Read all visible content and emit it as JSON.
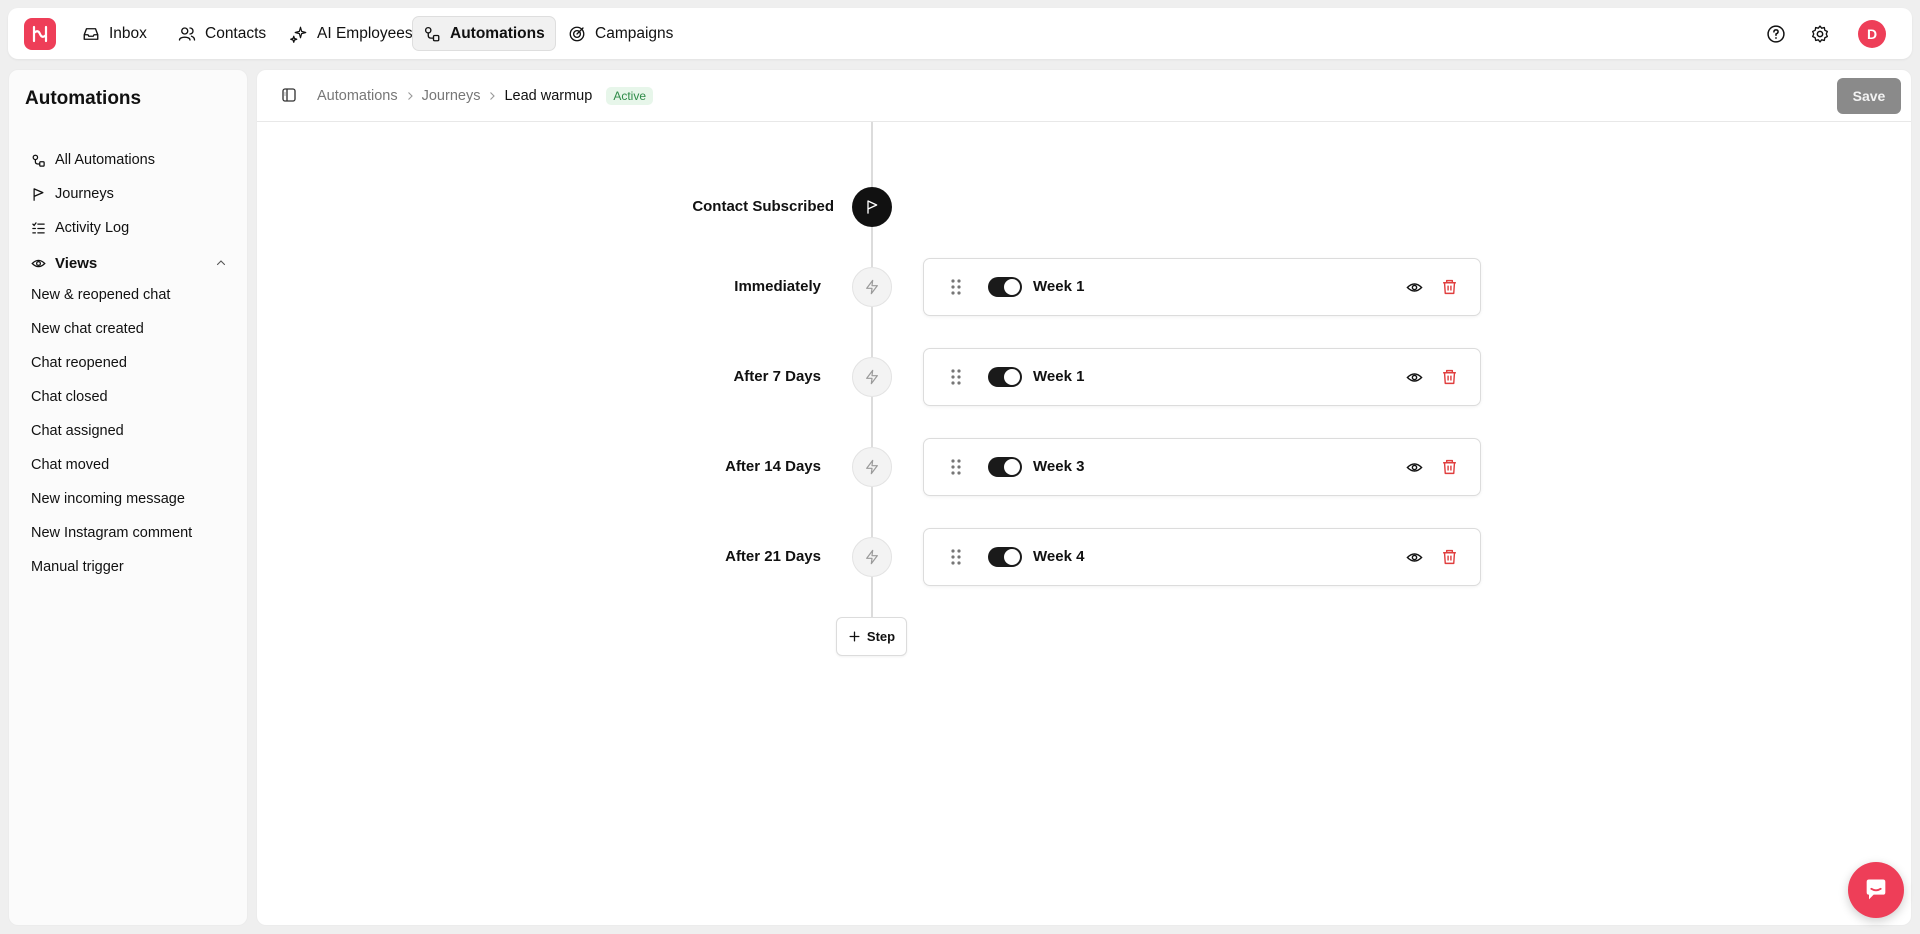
{
  "colors": {
    "brand": "#ee3e58",
    "active_badge_bg": "#e7f6ea",
    "active_badge_text": "#2e8b48",
    "delete": "#e03e3e"
  },
  "topnav": {
    "items": [
      {
        "label": "Inbox",
        "icon": "inbox-icon"
      },
      {
        "label": "Contacts",
        "icon": "users-icon"
      },
      {
        "label": "AI Employees",
        "icon": "sparkles-icon"
      },
      {
        "label": "Automations",
        "icon": "automation-icon",
        "active": true
      },
      {
        "label": "Campaigns",
        "icon": "target-icon"
      }
    ],
    "avatar_initial": "D"
  },
  "sidebar": {
    "title": "Automations",
    "items": [
      {
        "label": "All Automations",
        "icon": "automation-icon"
      },
      {
        "label": "Journeys",
        "icon": "flag-icon"
      },
      {
        "label": "Activity Log",
        "icon": "list-check-icon"
      }
    ],
    "views_label": "Views",
    "views": [
      "New & reopened chat",
      "New chat created",
      "Chat reopened",
      "Chat closed",
      "Chat assigned",
      "Chat moved",
      "New incoming message",
      "New Instagram comment",
      "Manual trigger"
    ]
  },
  "header": {
    "breadcrumb": [
      "Automations",
      "Journeys",
      "Lead warmup"
    ],
    "status": "Active",
    "save_label": "Save"
  },
  "journey": {
    "trigger_label": "Contact Subscribed",
    "steps": [
      {
        "timing": "Immediately",
        "title": "Week 1",
        "enabled": true
      },
      {
        "timing": "After 7 Days",
        "title": "Week 1",
        "enabled": true
      },
      {
        "timing": "After 14 Days",
        "title": "Week 3",
        "enabled": true
      },
      {
        "timing": "After 21 Days",
        "title": "Week 4",
        "enabled": true
      }
    ],
    "add_step_label": "Step"
  }
}
